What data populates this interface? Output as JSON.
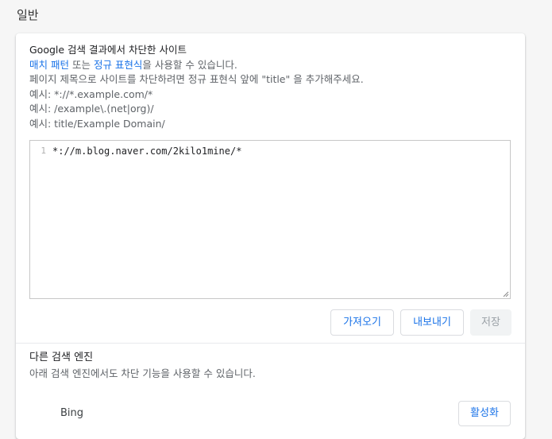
{
  "section_title": "일반",
  "blocked_sites": {
    "title": "Google 검색 결과에서 차단한 사이트",
    "usage_link_match": "매치 패턴",
    "usage_or": " 또는 ",
    "usage_link_regex": "정규 표현식",
    "usage_suffix": "을 사용할 수 있습니다.",
    "title_hint": "페이지 제목으로 사이트를 차단하려면 정규 표현식 앞에 \"title\" 을 추가해주세요.",
    "example1": "예시: *://*.example.com/*",
    "example2": "예시: /example\\.(net|org)/",
    "example3": "예시: title/Example Domain/",
    "editor": {
      "line_number": "1",
      "content": "*://m.blog.naver.com/2kilo1mine/*"
    },
    "buttons": {
      "import": "가져오기",
      "export": "내보내기",
      "save": "저장"
    }
  },
  "other_engines": {
    "title": "다른 검색 엔진",
    "description": "아래 검색 엔진에서도 차단 기능을 사용할 수 있습니다.",
    "engines": [
      {
        "name": "Bing",
        "action": "활성화"
      }
    ]
  },
  "colors": {
    "link": "#1a73e8",
    "disabled_bg": "#f1f3f4",
    "disabled_text": "#9aa0a6"
  }
}
